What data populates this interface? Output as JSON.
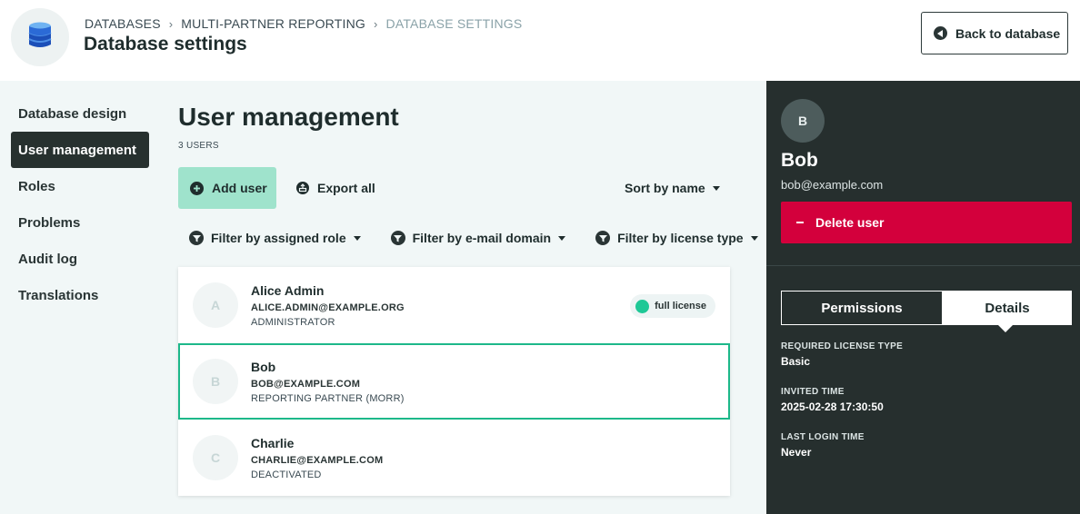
{
  "header": {
    "breadcrumb": [
      "Databases",
      "Multi-Partner Reporting",
      "Database Settings"
    ],
    "title": "Database settings",
    "back_label": "Back to database"
  },
  "sidenav": {
    "items": [
      {
        "label": "Database design",
        "active": false
      },
      {
        "label": "User management",
        "active": true
      },
      {
        "label": "Roles",
        "active": false
      },
      {
        "label": "Problems",
        "active": false
      },
      {
        "label": "Audit log",
        "active": false
      },
      {
        "label": "Translations",
        "active": false
      }
    ]
  },
  "users_section": {
    "title": "User management",
    "count": "3 users",
    "add_user_label": "Add user",
    "export_label": "Export all",
    "sort_label": "Sort by name",
    "filters": [
      "Filter by assigned role",
      "Filter by e-mail domain",
      "Filter by license type"
    ],
    "users": [
      {
        "initial": "A",
        "name": "Alice Admin",
        "email": "ALICE.ADMIN@EXAMPLE.ORG",
        "role": "ADMINISTRATOR",
        "license": "full license",
        "selected": false
      },
      {
        "initial": "B",
        "name": "Bob",
        "email": "BOB@EXAMPLE.COM",
        "role": "REPORTING PARTNER (MORR)",
        "license": "",
        "selected": true
      },
      {
        "initial": "C",
        "name": "Charlie",
        "email": "CHARLIE@EXAMPLE.COM",
        "role": "DEACTIVATED",
        "license": "",
        "selected": false
      }
    ]
  },
  "panel": {
    "initial": "B",
    "name": "Bob",
    "email": "bob@example.com",
    "delete_label": "Delete user",
    "tabs": {
      "permissions": "Permissions",
      "details": "Details"
    },
    "fields": [
      {
        "label": "Required license type",
        "value": "Basic"
      },
      {
        "label": "Invited time",
        "value": "2025-02-28 17:30:50"
      },
      {
        "label": "Last login time",
        "value": "Never"
      }
    ]
  },
  "colors": {
    "accent_green": "#1db88a",
    "add_button": "#9fe3cc",
    "delete_red": "#d3003c",
    "panel_bg": "#262f2e",
    "main_bg": "#f1f7f7"
  },
  "icons": {
    "logo": "database-icon",
    "back": "back-arrow-icon",
    "add": "plus-circle-icon",
    "export": "export-icon",
    "filter": "filter-icon",
    "delete": "minus-icon"
  }
}
